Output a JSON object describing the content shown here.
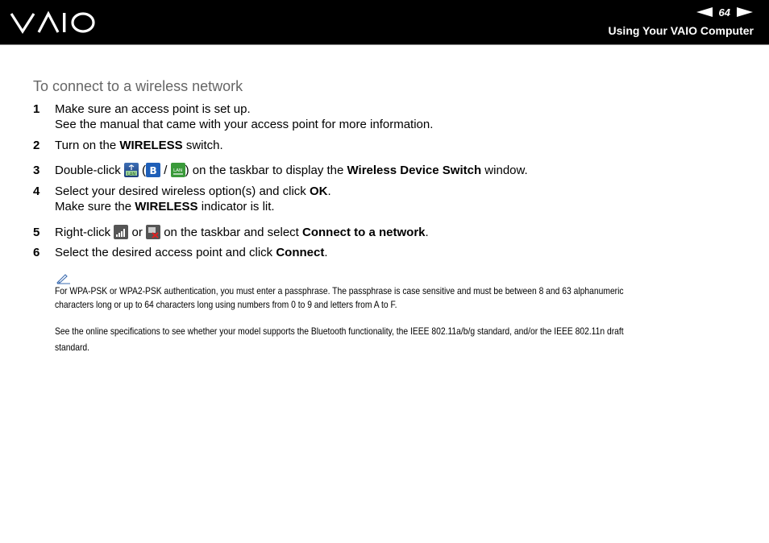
{
  "header": {
    "page_number": "64",
    "section_title": "Using Your VAIO Computer",
    "logo_icon": "vaio-logo",
    "prev_icon": "left-arrow-icon",
    "next_icon": "right-arrow-icon"
  },
  "heading": "To connect to a wireless network",
  "steps": [
    {
      "num": "1",
      "line1": "Make sure an access point is set up.",
      "line2": "See the manual that came with your access point for more information."
    },
    {
      "num": "2",
      "pre": "Turn on the ",
      "bold": "WIRELESS",
      "post": " switch."
    },
    {
      "num": "3",
      "pre": "Double-click ",
      "paren_open": "(",
      "slash": "/",
      "mid": ") on the taskbar to display the ",
      "bold": "Wireless Device Switch",
      "post": " window.",
      "icons": [
        "wireless-lan-icon",
        "bluetooth-icon",
        "wireless-lan-icon"
      ]
    },
    {
      "num": "4",
      "pre": "Select your desired wireless option(s) and click ",
      "bold": "OK",
      "post": ".",
      "line2_pre": "Make sure the ",
      "line2_bold": "WIRELESS",
      "line2_post": " indicator is lit."
    },
    {
      "num": "5",
      "pre": "Right-click ",
      "or": "or",
      "mid": "on the taskbar and select ",
      "bold": "Connect to a network",
      "post": ".",
      "icons": [
        "network-signal-icon",
        "network-disconnected-icon"
      ]
    },
    {
      "num": "6",
      "pre": "Select the desired access point and click ",
      "bold": "Connect",
      "post": "."
    }
  ],
  "notes": {
    "icon": "pencil-note-icon",
    "note1": "For WPA-PSK or WPA2-PSK authentication, you must enter a passphrase. The passphrase is case sensitive and must be between 8 and 63 alphanumeric characters long or up to 64 characters long using numbers from 0 to 9 and letters from A to F.",
    "note2": "See the online specifications to see whether your model supports the Bluetooth functionality, the IEEE 802.11a/b/g standard, and/or the IEEE 802.11n draft standard."
  },
  "colors": {
    "header_bg": "#000000",
    "heading": "#666666",
    "bluetooth": "#1f5fb8",
    "lan_green": "#3a9a3a"
  }
}
